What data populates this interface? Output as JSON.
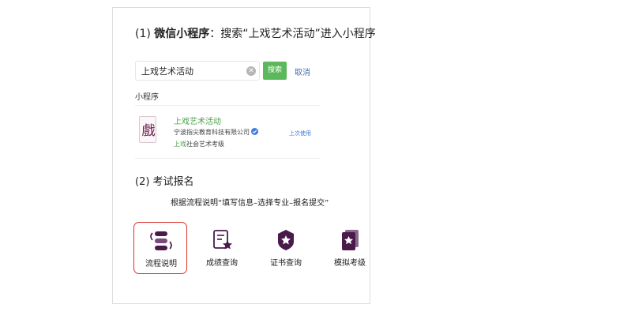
{
  "section1": {
    "prefix": "(1) ",
    "title_bold": "微信小程序",
    "title_rest": "：搜索“上戏艺术活动”进入小程序"
  },
  "search": {
    "value": "上戏艺术活动",
    "button_label": "搜索",
    "cancel_label": "取消"
  },
  "mini_program": {
    "section_label": "小程序",
    "name": "上戏艺术活动",
    "company": "宁波指尖教育科技有限公司",
    "subtitle_brand": "上戏",
    "subtitle_rest": "社会艺术考级",
    "last_used": "上次使用",
    "logo_glyph": "戲"
  },
  "section2": {
    "title": "(2) 考试报名",
    "flow_text": "根据流程说明“填写信息–选择专业–报名提交”"
  },
  "menu": [
    {
      "label": "流程说明",
      "icon": "process-icon",
      "highlighted": true
    },
    {
      "label": "成绩查询",
      "icon": "score-query-icon",
      "highlighted": false
    },
    {
      "label": "证书查询",
      "icon": "certificate-query-icon",
      "highlighted": false
    },
    {
      "label": "模拟考级",
      "icon": "mock-exam-icon",
      "highlighted": false
    }
  ],
  "colors": {
    "accent_purple": "#4a1a4a",
    "search_green": "#5cb85c",
    "highlight_red": "#d9342c",
    "link_blue": "#3f6fb5"
  }
}
